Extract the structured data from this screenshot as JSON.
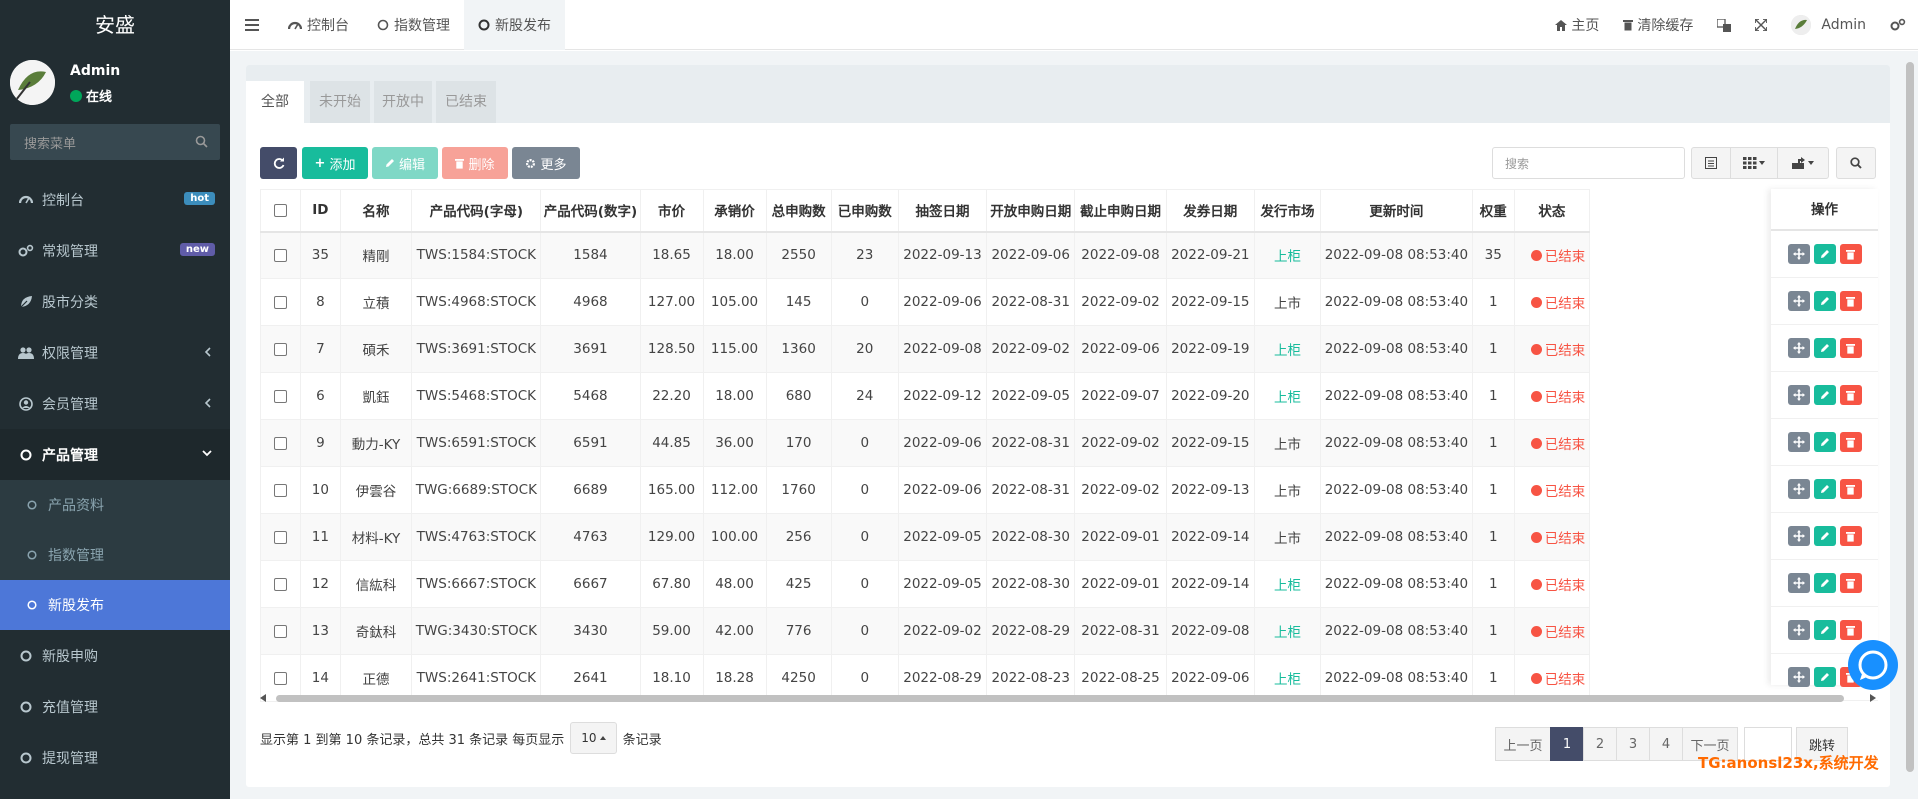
{
  "app": {
    "title": "安盛"
  },
  "user": {
    "name": "Admin",
    "status": "在线"
  },
  "sidebar": {
    "search_placeholder": "搜索菜单",
    "items": [
      {
        "label": "控制台",
        "badge": "hot",
        "badge_color": "#3c8dbc"
      },
      {
        "label": "常规管理",
        "badge": "new",
        "badge_color": "#605ca8"
      },
      {
        "label": "股市分类"
      },
      {
        "label": "权限管理"
      },
      {
        "label": "会员管理"
      },
      {
        "label": "产品管理"
      },
      {
        "label": "产品资料"
      },
      {
        "label": "指数管理"
      },
      {
        "label": "新股发布"
      },
      {
        "label": "新股申购"
      },
      {
        "label": "充值管理"
      },
      {
        "label": "提现管理"
      }
    ]
  },
  "navbar": {
    "tabs": [
      {
        "label": "控制台"
      },
      {
        "label": "指数管理"
      },
      {
        "label": "新股发布"
      }
    ],
    "right": {
      "home": "主页",
      "clear_cache": "清除缓存",
      "admin": "Admin"
    }
  },
  "content_tabs": [
    "全部",
    "未开始",
    "开放中",
    "已结束"
  ],
  "toolbar": {
    "add": "添加",
    "edit": "编辑",
    "delete": "删除",
    "more": "更多",
    "search_placeholder": "搜索"
  },
  "table": {
    "headers": [
      "ID",
      "名称",
      "产品代码(字母)",
      "产品代码(数字)",
      "市价",
      "承销价",
      "总申购数",
      "已申购数",
      "抽签日期",
      "开放申购日期",
      "截止申购日期",
      "发券日期",
      "发行市场",
      "更新时间",
      "权重",
      "状态",
      "操作"
    ],
    "rows": [
      {
        "id": "35",
        "name": "精剛",
        "code_alpha": "TWS:1584:STOCK",
        "code_num": "1584",
        "price": "18.65",
        "underwrite": "18.00",
        "total": "2550",
        "applied": "23",
        "draw": "2022-09-13",
        "open": "2022-09-06",
        "close": "2022-09-08",
        "issue": "2022-09-21",
        "market": "上柜",
        "updated": "2022-09-08 08:53:40",
        "weight": "35",
        "status": "已结束"
      },
      {
        "id": "8",
        "name": "立積",
        "code_alpha": "TWS:4968:STOCK",
        "code_num": "4968",
        "price": "127.00",
        "underwrite": "105.00",
        "total": "145",
        "applied": "0",
        "draw": "2022-09-06",
        "open": "2022-08-31",
        "close": "2022-09-02",
        "issue": "2022-09-15",
        "market": "上市",
        "updated": "2022-09-08 08:53:40",
        "weight": "1",
        "status": "已结束"
      },
      {
        "id": "7",
        "name": "碩禾",
        "code_alpha": "TWS:3691:STOCK",
        "code_num": "3691",
        "price": "128.50",
        "underwrite": "115.00",
        "total": "1360",
        "applied": "20",
        "draw": "2022-09-08",
        "open": "2022-09-02",
        "close": "2022-09-06",
        "issue": "2022-09-19",
        "market": "上柜",
        "updated": "2022-09-08 08:53:40",
        "weight": "1",
        "status": "已结束"
      },
      {
        "id": "6",
        "name": "凱鈺",
        "code_alpha": "TWS:5468:STOCK",
        "code_num": "5468",
        "price": "22.20",
        "underwrite": "18.00",
        "total": "680",
        "applied": "24",
        "draw": "2022-09-12",
        "open": "2022-09-05",
        "close": "2022-09-07",
        "issue": "2022-09-20",
        "market": "上柜",
        "updated": "2022-09-08 08:53:40",
        "weight": "1",
        "status": "已结束"
      },
      {
        "id": "9",
        "name": "動力-KY",
        "code_alpha": "TWS:6591:STOCK",
        "code_num": "6591",
        "price": "44.85",
        "underwrite": "36.00",
        "total": "170",
        "applied": "0",
        "draw": "2022-09-06",
        "open": "2022-08-31",
        "close": "2022-09-02",
        "issue": "2022-09-15",
        "market": "上市",
        "updated": "2022-09-08 08:53:40",
        "weight": "1",
        "status": "已结束"
      },
      {
        "id": "10",
        "name": "伊雲谷",
        "code_alpha": "TWG:6689:STOCK",
        "code_num": "6689",
        "price": "165.00",
        "underwrite": "112.00",
        "total": "1760",
        "applied": "0",
        "draw": "2022-09-06",
        "open": "2022-08-31",
        "close": "2022-09-02",
        "issue": "2022-09-13",
        "market": "上市",
        "updated": "2022-09-08 08:53:40",
        "weight": "1",
        "status": "已结束"
      },
      {
        "id": "11",
        "name": "材料-KY",
        "code_alpha": "TWS:4763:STOCK",
        "code_num": "4763",
        "price": "129.00",
        "underwrite": "100.00",
        "total": "256",
        "applied": "0",
        "draw": "2022-09-05",
        "open": "2022-08-30",
        "close": "2022-09-01",
        "issue": "2022-09-14",
        "market": "上市",
        "updated": "2022-09-08 08:53:40",
        "weight": "1",
        "status": "已结束"
      },
      {
        "id": "12",
        "name": "信紘科",
        "code_alpha": "TWS:6667:STOCK",
        "code_num": "6667",
        "price": "67.80",
        "underwrite": "48.00",
        "total": "425",
        "applied": "0",
        "draw": "2022-09-05",
        "open": "2022-08-30",
        "close": "2022-09-01",
        "issue": "2022-09-14",
        "market": "上柜",
        "updated": "2022-09-08 08:53:40",
        "weight": "1",
        "status": "已结束"
      },
      {
        "id": "13",
        "name": "奇鈦科",
        "code_alpha": "TWG:3430:STOCK",
        "code_num": "3430",
        "price": "59.00",
        "underwrite": "42.00",
        "total": "776",
        "applied": "0",
        "draw": "2022-09-02",
        "open": "2022-08-29",
        "close": "2022-08-31",
        "issue": "2022-09-08",
        "market": "上柜",
        "updated": "2022-09-08 08:53:40",
        "weight": "1",
        "status": "已结束"
      },
      {
        "id": "14",
        "name": "正德",
        "code_alpha": "TWS:2641:STOCK",
        "code_num": "2641",
        "price": "18.10",
        "underwrite": "18.28",
        "total": "4250",
        "applied": "0",
        "draw": "2022-08-29",
        "open": "2022-08-23",
        "close": "2022-08-25",
        "issue": "2022-09-06",
        "market": "上柜",
        "updated": "2022-09-08 08:53:40",
        "weight": "1",
        "status": "已结束"
      }
    ]
  },
  "pagination": {
    "summary": "显示第 1 到第 10 条记录，总共 31 条记录 每页显示",
    "page_size": "10",
    "suffix": "条记录",
    "prev": "上一页",
    "pages": [
      "1",
      "2",
      "3",
      "4"
    ],
    "next": "下一页",
    "jump": "跳转"
  },
  "watermark": "TG:anonsl23x,系统开发",
  "colors": {
    "sidebar_bg": "#222d32",
    "selected": "#4d77d8",
    "add": "#18bc9c",
    "edit": "#7fd8c6",
    "delete": "#f7a298",
    "more": "#7a8693",
    "refresh": "#444c69",
    "market_green": "#18bc9c",
    "status_red": "#f75444"
  }
}
